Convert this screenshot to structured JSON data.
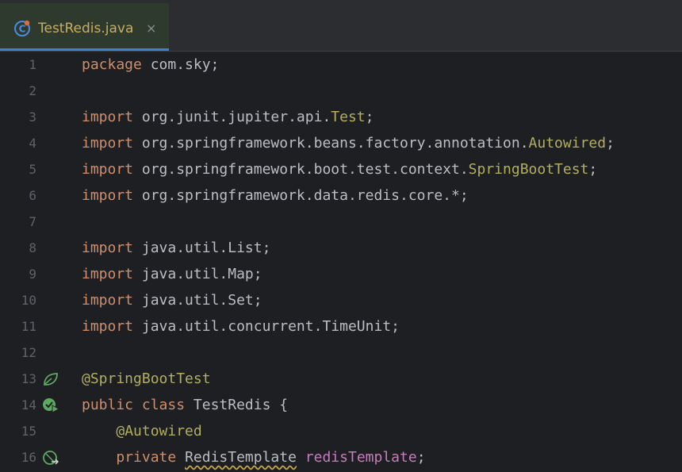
{
  "tab": {
    "title": "TestRedis.java",
    "close_glyph": "×",
    "icon": "java-class-icon",
    "accent": "#3d7fd6"
  },
  "gutter": {
    "line_numbers": [
      "1",
      "2",
      "3",
      "4",
      "5",
      "6",
      "7",
      "8",
      "9",
      "10",
      "11",
      "12",
      "13",
      "14",
      "15",
      "16"
    ],
    "icons": {
      "13": "spring-bean-icon",
      "14": "run-test-icon",
      "16": "autowired-navigate-icon"
    }
  },
  "code": {
    "l1": {
      "kw": "package",
      "rest": " com.sky;"
    },
    "l3": {
      "kw": "import",
      "pkg": " org.junit.jupiter.api.",
      "cls": "Test",
      "end": ";"
    },
    "l4": {
      "kw": "import",
      "pkg": " org.springframework.beans.factory.annotation.",
      "cls": "Autowired",
      "end": ";"
    },
    "l5": {
      "kw": "import",
      "pkg": " org.springframework.boot.test.context.",
      "cls": "SpringBootTest",
      "end": ";"
    },
    "l6": {
      "kw": "import",
      "rest": " org.springframework.data.redis.core.*;"
    },
    "l8": {
      "kw": "import",
      "rest": " java.util.List;"
    },
    "l9": {
      "kw": "import",
      "rest": " java.util.Map;"
    },
    "l10": {
      "kw": "import",
      "rest": " java.util.Set;"
    },
    "l11": {
      "kw": "import",
      "rest": " java.util.concurrent.TimeUnit;"
    },
    "l13": {
      "ann": "@SpringBootTest"
    },
    "l14": {
      "kw1": "public",
      "kw2": "class",
      "rest": " TestRedis {"
    },
    "l15": {
      "indent": "    ",
      "ann": "@Autowired"
    },
    "l16": {
      "indent": "    ",
      "kw": "private",
      "type": "RedisTemplate",
      "field": "redisTemplate",
      "end": ";"
    }
  },
  "colors": {
    "background": "#1e1f22",
    "keyword": "#cf8e6d",
    "annotation": "#b3ae60",
    "field": "#c77dbb",
    "text": "#bcbec4"
  }
}
